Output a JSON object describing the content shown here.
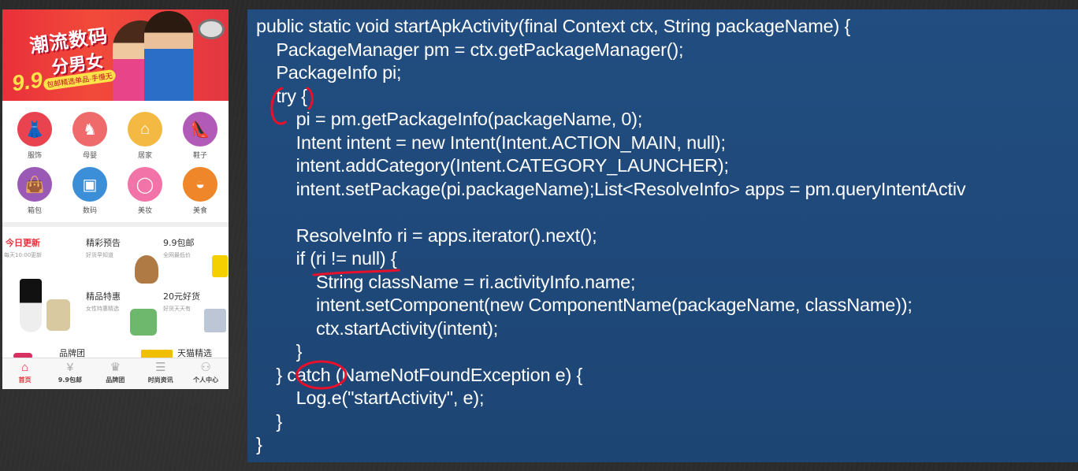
{
  "phone": {
    "banner": {
      "title_line1": "潮流数码",
      "title_line2": "分男女",
      "price": "9.9",
      "tag": "包邮精选单品·手慢无"
    },
    "categories": [
      {
        "label": "服饰",
        "color": "#e8434f",
        "icon": "dress-icon",
        "glyph": "👗"
      },
      {
        "label": "母婴",
        "color": "#ef6a6a",
        "icon": "rocking-horse-icon",
        "glyph": "♞"
      },
      {
        "label": "居家",
        "color": "#f4b942",
        "icon": "basket-icon",
        "glyph": "⌂"
      },
      {
        "label": "鞋子",
        "color": "#b25ab8",
        "icon": "shoe-icon",
        "glyph": "👠"
      },
      {
        "label": "箱包",
        "color": "#9b59b6",
        "icon": "bag-icon",
        "glyph": "👜"
      },
      {
        "label": "数码",
        "color": "#3a8fd8",
        "icon": "devices-icon",
        "glyph": "▣"
      },
      {
        "label": "美妆",
        "color": "#f273a7",
        "icon": "ring-icon",
        "glyph": "◯"
      },
      {
        "label": "美食",
        "color": "#f0862a",
        "icon": "bowl-icon",
        "glyph": "◒"
      }
    ],
    "promo": {
      "today_title": "今日更新",
      "today_sub": "每天10:00更新",
      "preview_title": "精彩预告",
      "preview_sub": "好货早知道",
      "free_ship_title": "9.9包邮",
      "free_ship_sub": "全网最低价",
      "special_title": "精品特惠",
      "special_sub": "女性特惠精选",
      "twenty_title": "20元好货",
      "twenty_sub": "好货天天有",
      "brand_title": "品牌团",
      "tmall_title": "天猫精选"
    },
    "tabs": [
      {
        "label": "首页",
        "icon": "home-icon",
        "glyph": "⌂",
        "active": true
      },
      {
        "label": "9.9包邮",
        "icon": "coin-icon",
        "glyph": "¥",
        "active": false
      },
      {
        "label": "品牌团",
        "icon": "crown-icon",
        "glyph": "♛",
        "active": false
      },
      {
        "label": "时尚资讯",
        "icon": "list-icon",
        "glyph": "☰",
        "active": false
      },
      {
        "label": "个人中心",
        "icon": "person-icon",
        "glyph": "⚇",
        "active": false
      }
    ]
  },
  "code": {
    "lines": [
      "public static void startApkActivity(final Context ctx, String packageName) {",
      "    PackageManager pm = ctx.getPackageManager();",
      "    PackageInfo pi;",
      "    try {",
      "        pi = pm.getPackageInfo(packageName, 0);",
      "        Intent intent = new Intent(Intent.ACTION_MAIN, null);",
      "        intent.addCategory(Intent.CATEGORY_LAUNCHER);",
      "        intent.setPackage(pi.packageName);List<ResolveInfo> apps = pm.queryIntentActiv",
      "",
      "        ResolveInfo ri = apps.iterator().next();",
      "        if (ri != null) {",
      "            String className = ri.activityInfo.name;",
      "            intent.setComponent(new ComponentName(packageName, className));",
      "            ctx.startActivity(intent);",
      "        }",
      "    } catch (NameNotFoundException e) {",
      "        Log.e(\"startActivity\", e);",
      "    }",
      "}"
    ],
    "annotation_color": "#e8102a"
  }
}
